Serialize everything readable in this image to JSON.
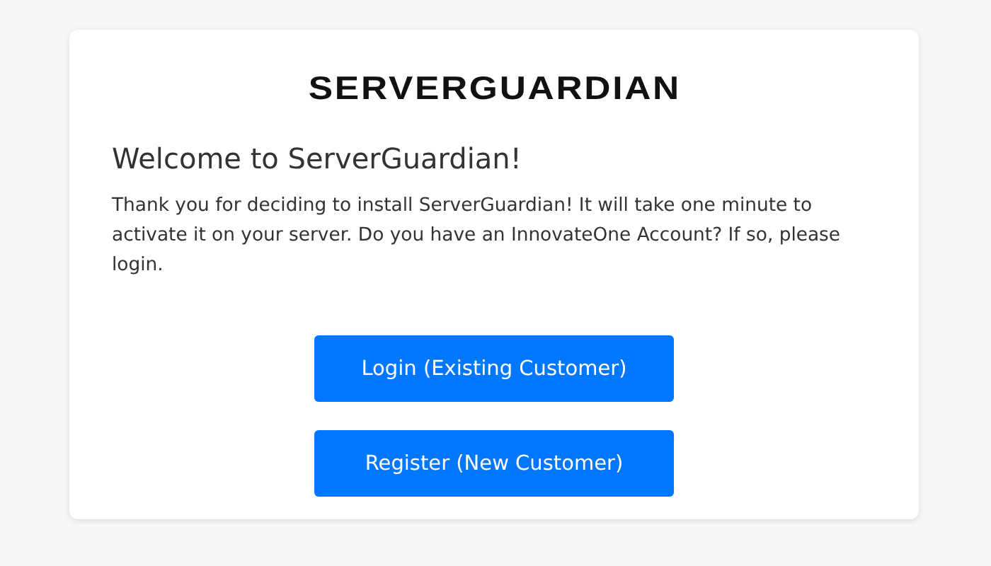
{
  "logo": "SERVERGUARDIAN",
  "heading": "Welcome to ServerGuardian!",
  "message": "Thank you for deciding to install ServerGuardian! It will take one minute to activate it on your server. Do you have an InnovateOne Account? If so, please login.",
  "buttons": [
    {
      "label": "Login (Existing Customer)"
    },
    {
      "label": "Register (New Customer)"
    }
  ]
}
